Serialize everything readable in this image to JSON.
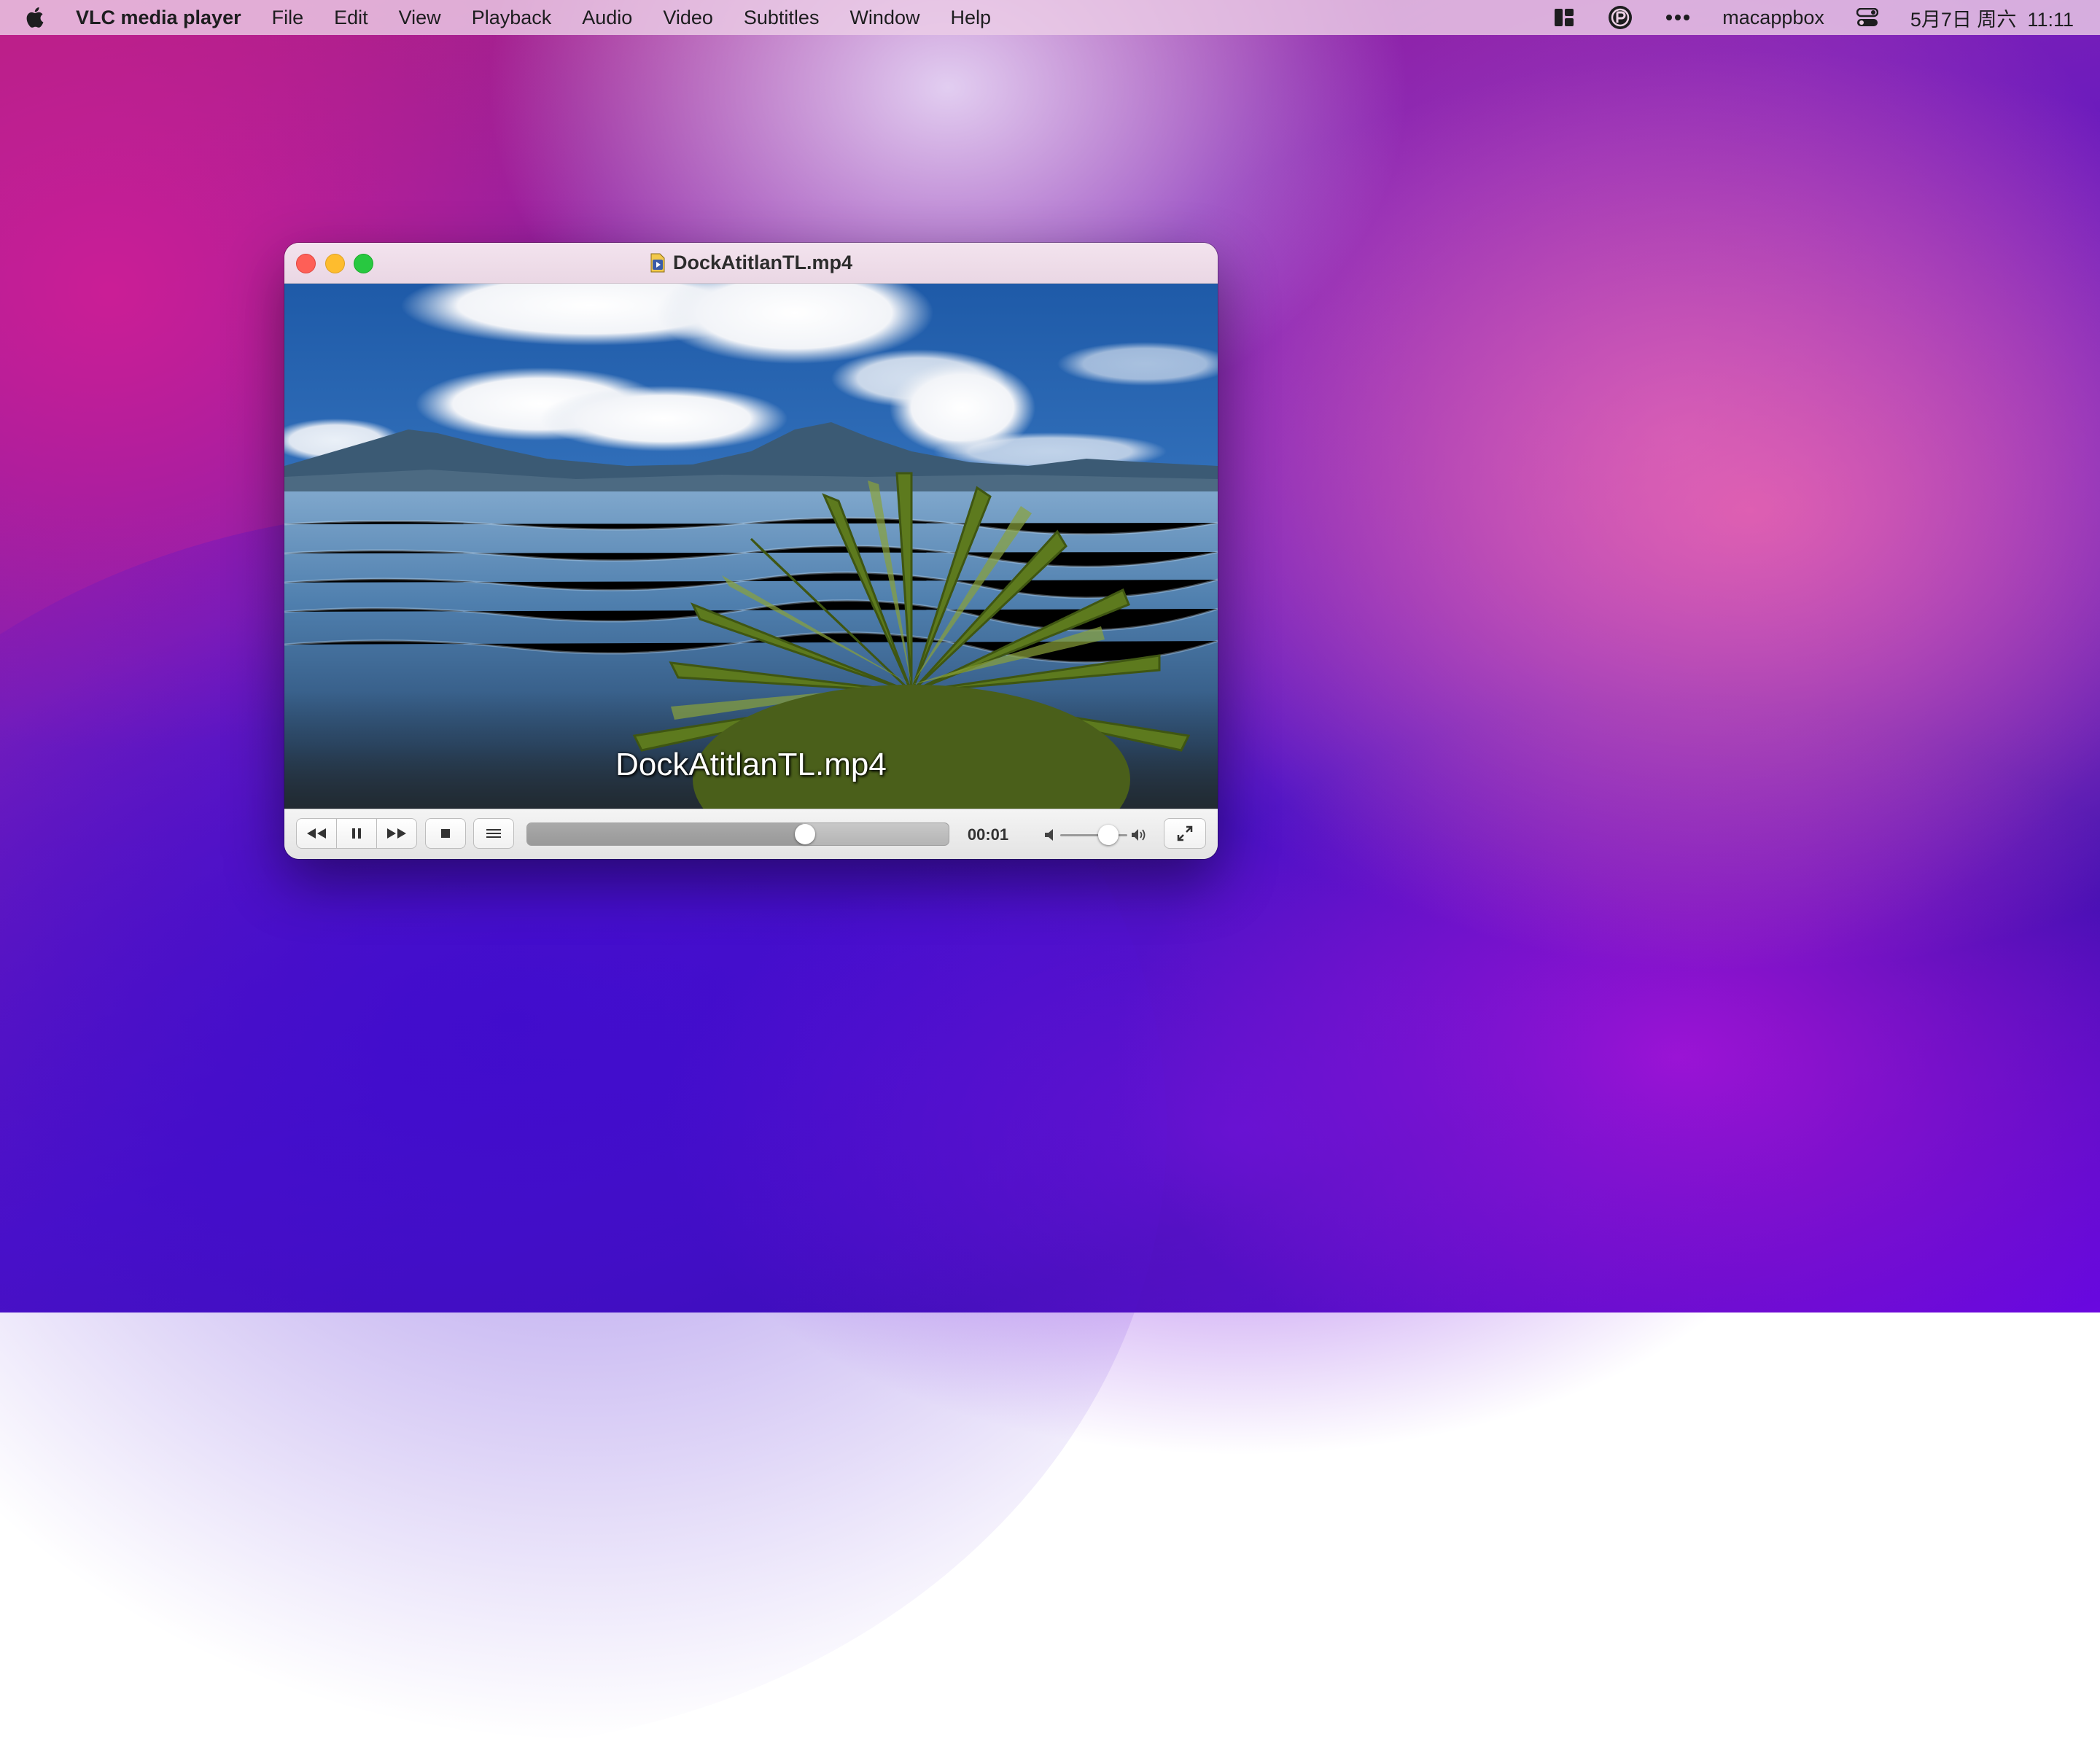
{
  "menubar": {
    "app_name": "VLC media player",
    "items": [
      "File",
      "Edit",
      "View",
      "Playback",
      "Audio",
      "Video",
      "Subtitles",
      "Window",
      "Help"
    ],
    "tray": {
      "user": "macappbox",
      "datetime": "5月7日 周六  11:11"
    },
    "icons": [
      "apple-icon",
      "window-layout-icon",
      "pasta-icon",
      "more-icon",
      "control-center-icon"
    ]
  },
  "window": {
    "title": "DockAtitlanTL.mp4",
    "subtitle_text": "DockAtitlanTL.mp4",
    "controls": {
      "time": "00:01",
      "progress": 0.66,
      "volume": 0.72,
      "state": "playing"
    }
  },
  "colors": {
    "close": "#fe5f57",
    "minimize": "#febc2e",
    "maximize": "#28c840"
  }
}
